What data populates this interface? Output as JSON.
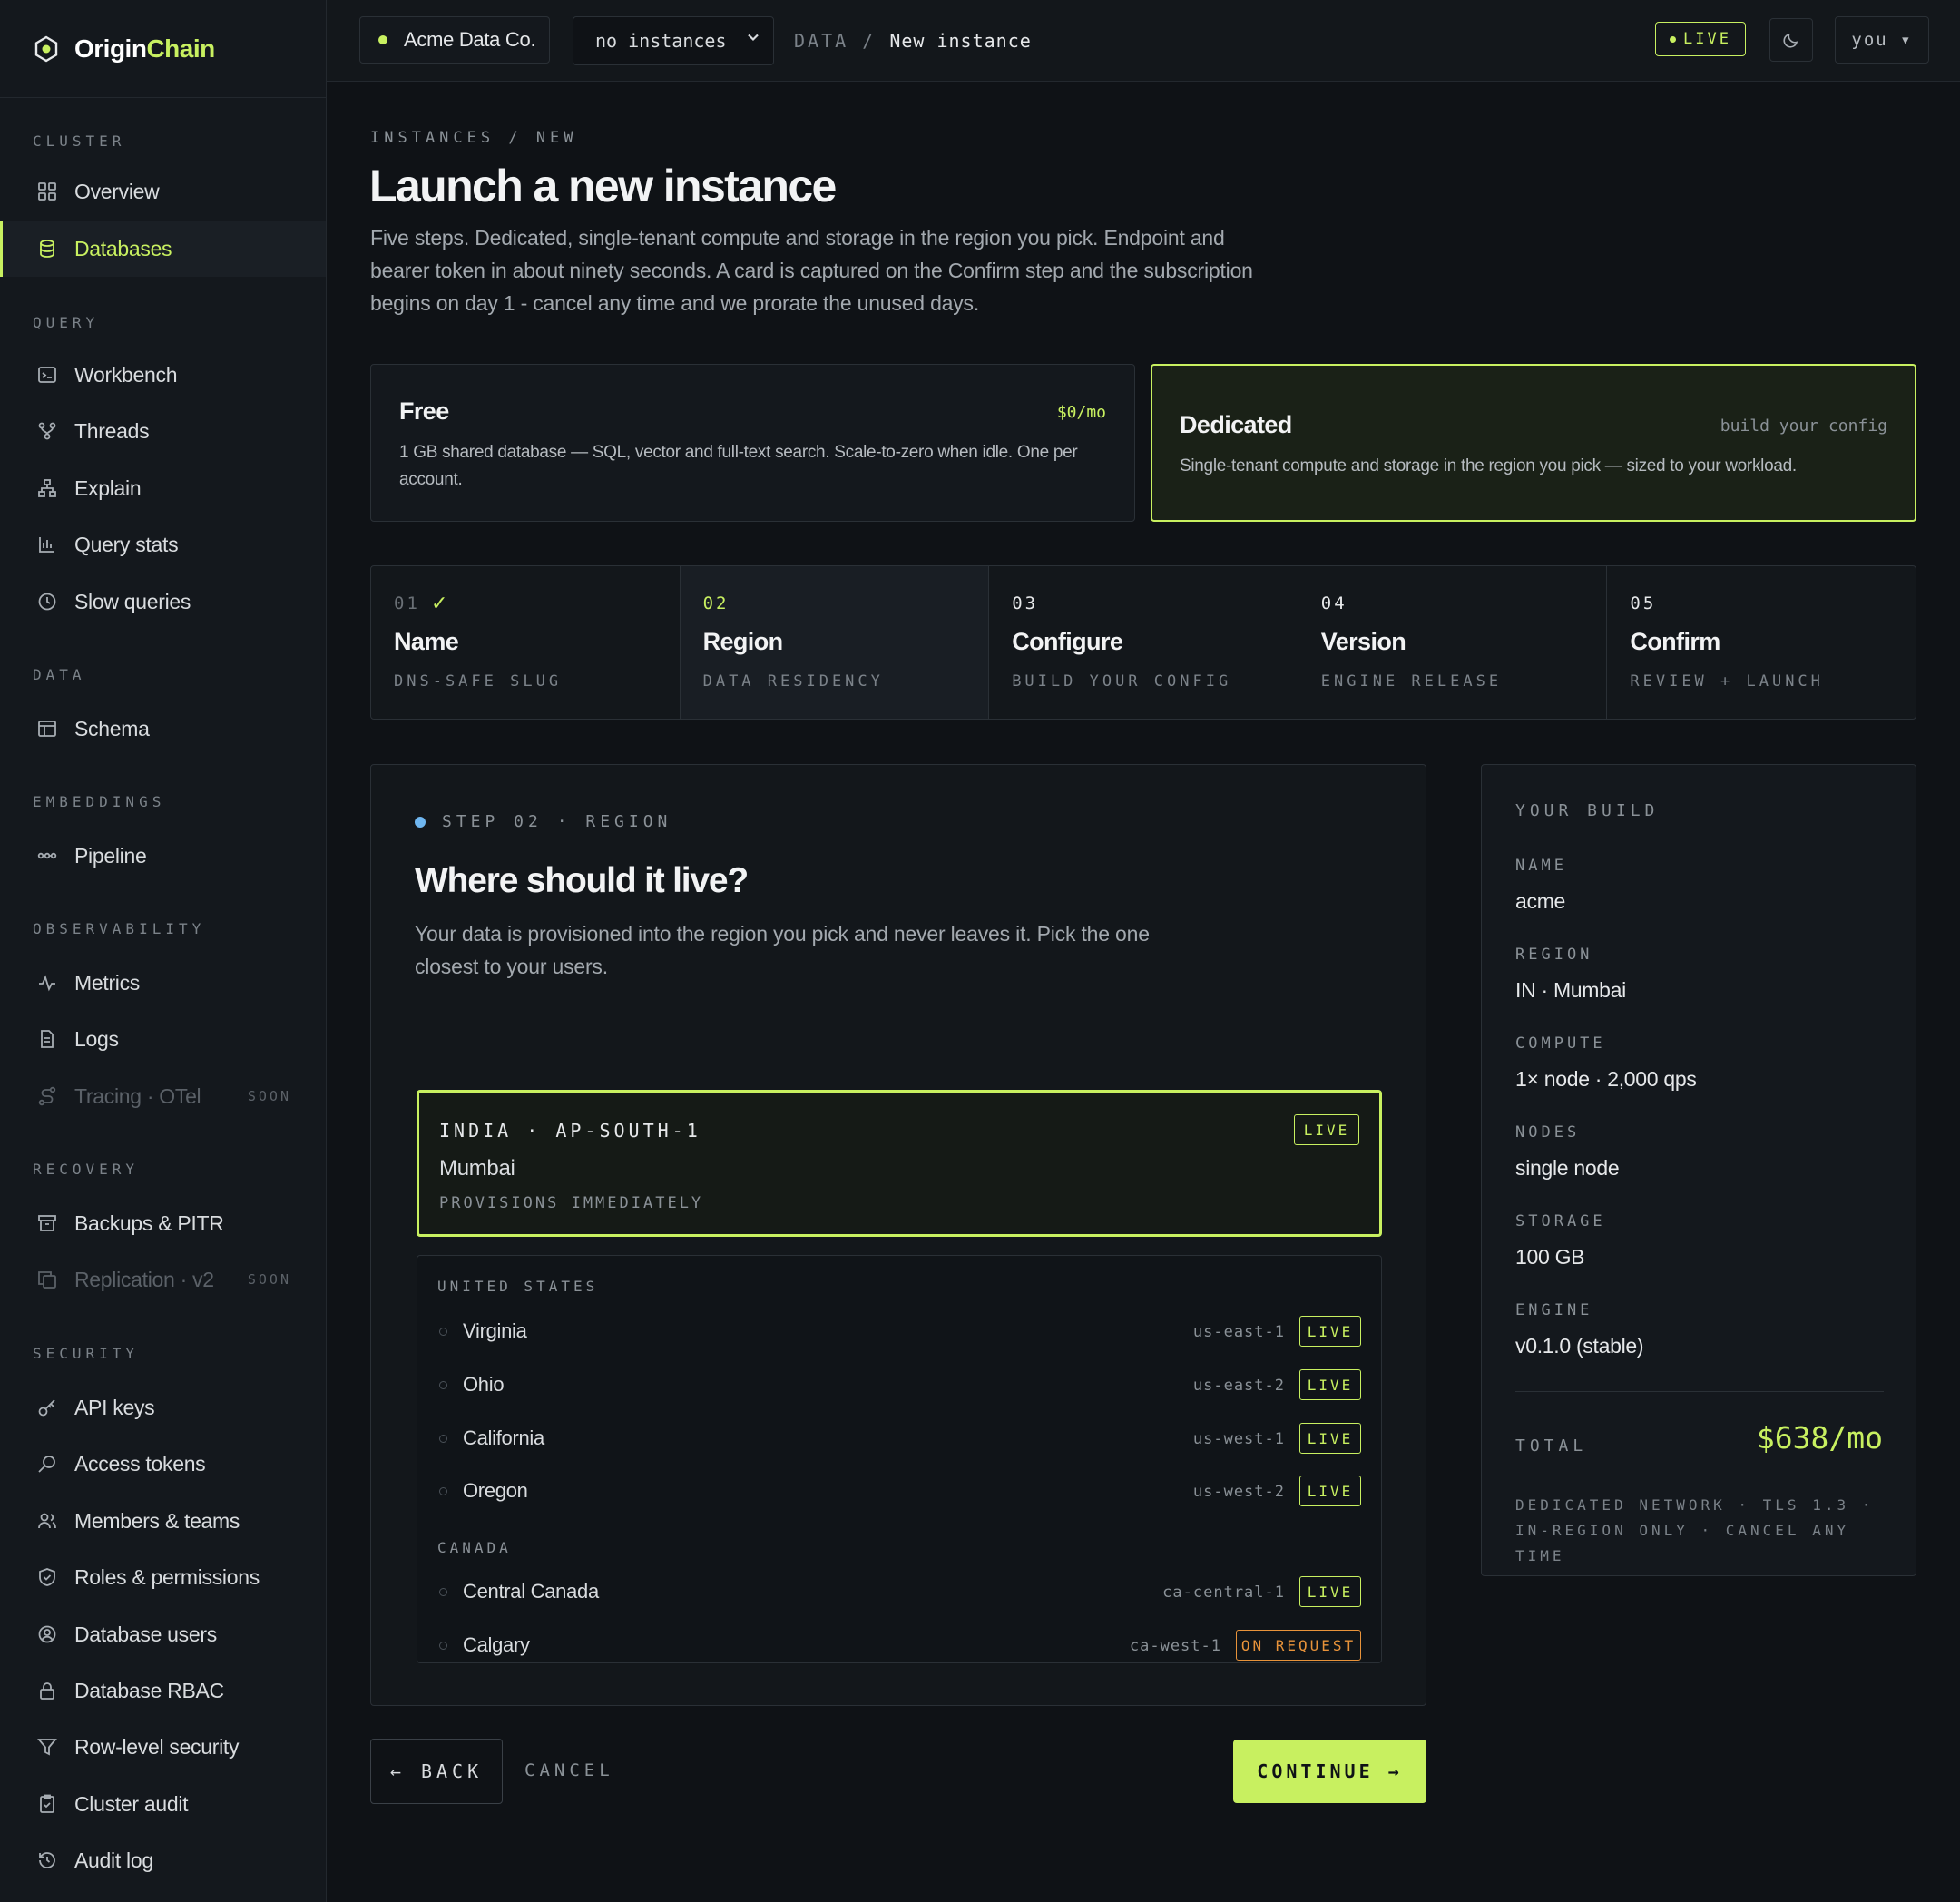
{
  "brand": {
    "name_a": "Origin",
    "name_b": "Chain"
  },
  "sidebar": {
    "sections": {
      "cluster": "CLUSTER",
      "query": "QUERY",
      "data": "DATA",
      "embeddings": "EMBEDDINGS",
      "observability": "OBSERVABILITY",
      "recovery": "RECOVERY",
      "security": "SECURITY"
    },
    "items": {
      "overview": "Overview",
      "databases": "Databases",
      "workbench": "Workbench",
      "threads": "Threads",
      "explain": "Explain",
      "query_stats": "Query stats",
      "slow_queries": "Slow queries",
      "schema": "Schema",
      "pipeline": "Pipeline",
      "metrics": "Metrics",
      "logs": "Logs",
      "tracing": "Tracing · OTel",
      "backups": "Backups & PITR",
      "replication": "Replication · v2",
      "api_keys": "API keys",
      "access_tokens": "Access tokens",
      "members": "Members & teams",
      "roles": "Roles & permissions",
      "db_users": "Database users",
      "db_rbac": "Database RBAC",
      "rls": "Row-level security",
      "cluster_audit": "Cluster audit",
      "audit_log": "Audit log"
    },
    "soon": "SOON",
    "active": "databases"
  },
  "topbar": {
    "org": "Acme Data Co.",
    "instance_select": "no instances",
    "crumb_section": "DATA",
    "crumb_sep": "/",
    "crumb_current": "New instance",
    "live": "LIVE",
    "user": "you ▾"
  },
  "page": {
    "eyebrow": "INSTANCES / NEW",
    "title": "Launch a new instance",
    "lead": "Five steps. Dedicated, single-tenant compute and storage in the region you pick. Endpoint and bearer token in about ninety seconds. A card is captured on the Confirm step and the subscription begins on day 1 - cancel any time and we prorate the unused days."
  },
  "plans": {
    "free": {
      "title": "Free",
      "price": "$0/mo",
      "desc": "1 GB shared database — SQL, vector and full-text search. Scale-to-zero when idle. One per account."
    },
    "dedicated": {
      "title": "Dedicated",
      "price": "build your config",
      "desc": "Single-tenant compute and storage in the region you pick — sized to your workload."
    }
  },
  "steps": [
    {
      "num": "01",
      "title": "Name",
      "sub": "DNS-SAFE SLUG",
      "state": "done"
    },
    {
      "num": "02",
      "title": "Region",
      "sub": "DATA RESIDENCY",
      "state": "current"
    },
    {
      "num": "03",
      "title": "Configure",
      "sub": "BUILD YOUR CONFIG",
      "state": "todo"
    },
    {
      "num": "04",
      "title": "Version",
      "sub": "ENGINE RELEASE",
      "state": "todo"
    },
    {
      "num": "05",
      "title": "Confirm",
      "sub": "REVIEW + LAUNCH",
      "state": "todo"
    }
  ],
  "region_card": {
    "eyebrow": "STEP 02 · REGION",
    "title": "Where should it live?",
    "desc": "Your data is provisioned into the region you pick and never leaves it. Pick the one closest to your users.",
    "selected": {
      "code": "INDIA · AP-SOUTH-1",
      "city": "Mumbai",
      "note": "PROVISIONS IMMEDIATELY",
      "badge": "LIVE"
    },
    "groups": [
      {
        "name": "UNITED STATES",
        "regions": [
          {
            "name": "Virginia",
            "code": "us-east-1",
            "status": "LIVE"
          },
          {
            "name": "Ohio",
            "code": "us-east-2",
            "status": "LIVE"
          },
          {
            "name": "California",
            "code": "us-west-1",
            "status": "LIVE"
          },
          {
            "name": "Oregon",
            "code": "us-west-2",
            "status": "LIVE"
          }
        ]
      },
      {
        "name": "CANADA",
        "regions": [
          {
            "name": "Central Canada",
            "code": "ca-central-1",
            "status": "LIVE"
          },
          {
            "name": "Calgary",
            "code": "ca-west-1",
            "status": "ON REQUEST"
          }
        ]
      }
    ]
  },
  "actions": {
    "back": "← BACK",
    "cancel": "CANCEL",
    "continue": "CONTINUE →"
  },
  "summary": {
    "title": "YOUR BUILD",
    "rows": [
      {
        "label": "NAME",
        "value": "acme"
      },
      {
        "label": "REGION",
        "value": "IN · Mumbai"
      },
      {
        "label": "COMPUTE",
        "value": "1× node · 2,000 qps"
      },
      {
        "label": "NODES",
        "value": "single node"
      },
      {
        "label": "STORAGE",
        "value": "100 GB"
      },
      {
        "label": "ENGINE",
        "value": "v0.1.0 (stable)"
      }
    ],
    "total_label": "TOTAL",
    "total_value": "$638/mo",
    "note": "DEDICATED NETWORK · TLS 1.3 · IN-REGION ONLY · CANCEL ANY TIME"
  },
  "colors": {
    "accent": "#c8f060",
    "warning": "#e8933a",
    "info": "#6fb6f0",
    "bg": "#0f1216"
  }
}
